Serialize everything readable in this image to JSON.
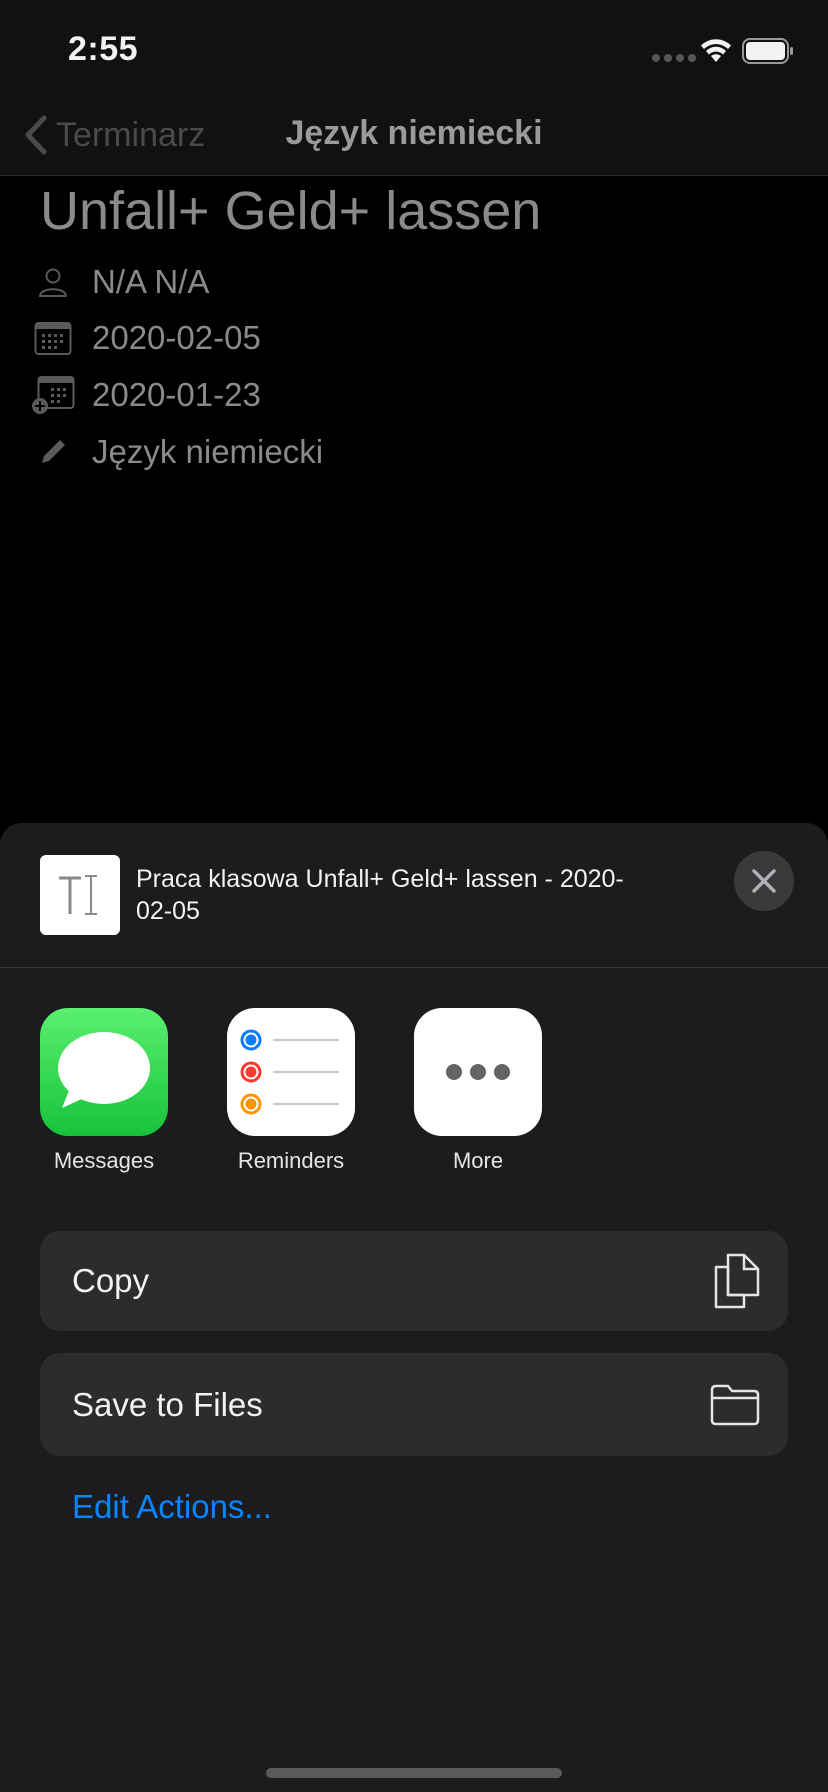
{
  "status_bar": {
    "time": "2:55"
  },
  "nav": {
    "back_label": "Terminarz",
    "title": "Język niemiecki"
  },
  "detail": {
    "title": "Unfall+ Geld+ lassen",
    "teacher": "N/A N/A",
    "due_date": "2020-02-05",
    "added_date": "2020-01-23",
    "subject": "Język niemiecki"
  },
  "share_sheet": {
    "title": "Praca klasowa Unfall+ Geld+ lassen - 2020-02-05",
    "apps": [
      {
        "label": "Messages",
        "icon": "messages-icon"
      },
      {
        "label": "Reminders",
        "icon": "reminders-icon"
      },
      {
        "label": "More",
        "icon": "more-icon"
      }
    ],
    "actions": [
      {
        "label": "Copy",
        "icon": "copy-icon"
      },
      {
        "label": "Save to Files",
        "icon": "folder-icon"
      }
    ],
    "edit_actions_label": "Edit Actions...",
    "colors": {
      "sheet_background": "#1c1c1e",
      "action_background": "#2c2c2e",
      "link": "#0a84ff",
      "messages_green": "#30d158"
    }
  }
}
